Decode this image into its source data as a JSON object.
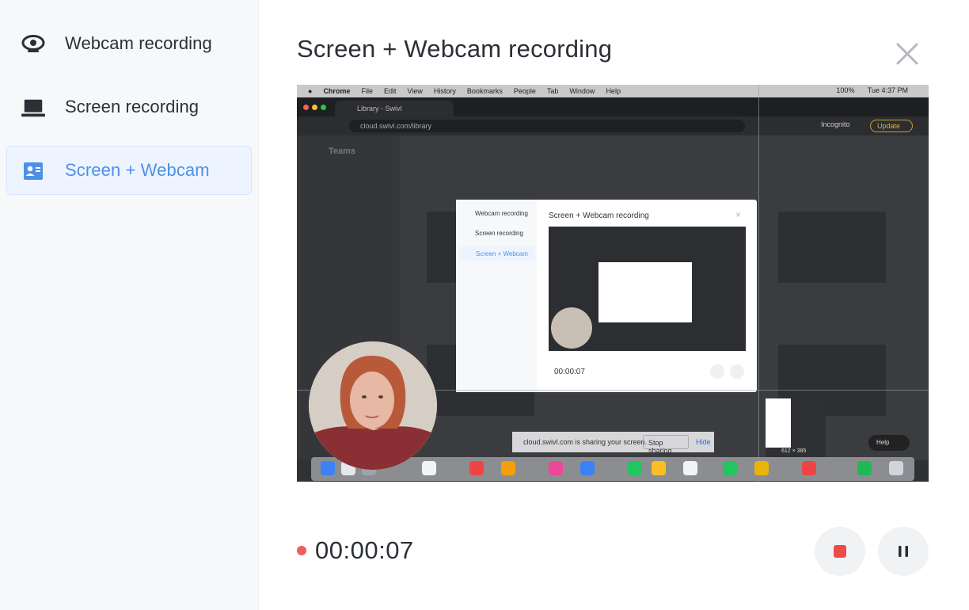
{
  "sidebar": {
    "items": [
      {
        "label": "Webcam recording",
        "icon": "webcam-icon",
        "active": false
      },
      {
        "label": "Screen recording",
        "icon": "laptop-icon",
        "active": false
      },
      {
        "label": "Screen + Webcam",
        "icon": "screen-webcam-icon",
        "active": true
      }
    ]
  },
  "header": {
    "title": "Screen + Webcam recording",
    "close_icon": "close-icon"
  },
  "preview": {
    "menubar": {
      "app": "Chrome",
      "menus": [
        "File",
        "Edit",
        "View",
        "History",
        "Bookmarks",
        "People",
        "Tab",
        "Window",
        "Help"
      ],
      "status": "100%",
      "clock": "Tue 4:37 PM"
    },
    "tab_title": "Library - Swivl",
    "url": "cloud.swivl.com/library",
    "incognito": "Incognito",
    "update": "Update",
    "app_title": "Teams",
    "inner_modal": {
      "items": [
        "Webcam recording",
        "Screen recording",
        "Screen + Webcam"
      ],
      "title": "Screen + Webcam recording",
      "close": "×",
      "time": "00:00:07"
    },
    "sharing_bar": {
      "message": "cloud.swivl.com is sharing your screen.",
      "stop": "Stop sharing",
      "hide": "Hide"
    },
    "help": "Help",
    "size_label": "612 × 385"
  },
  "controls": {
    "time": "00:00:07",
    "stop_icon": "stop-icon",
    "pause_icon": "pause-icon",
    "record_color": "#ef5d5d",
    "accent_color": "#4d90e8"
  }
}
